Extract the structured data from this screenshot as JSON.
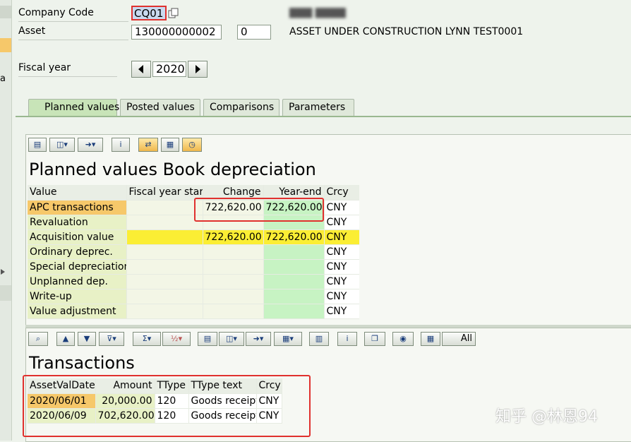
{
  "header": {
    "company_code_label": "Company Code",
    "company_code_value": "CQ01",
    "asset_label": "Asset",
    "asset_number": "130000000002",
    "asset_subnumber": "0",
    "asset_description": "ASSET UNDER CONSTRUCTION LYNN TEST0001",
    "company_name_blurred": "▇▇▇ ▇▇▇▇",
    "fiscal_year_label": "Fiscal year",
    "fiscal_year_value": "2020"
  },
  "left_strip": {
    "text": "a"
  },
  "tabs": [
    {
      "label": "Planned values",
      "active": true
    },
    {
      "label": "Posted values",
      "active": false
    },
    {
      "label": "Comparisons",
      "active": false
    },
    {
      "label": "Parameters",
      "active": false
    }
  ],
  "planned": {
    "title": "Planned values Book depreciation",
    "columns": [
      "Value",
      "Fiscal year start",
      "Change",
      "Year-end",
      "Crcy"
    ],
    "rows": [
      {
        "value": "APC transactions",
        "fy_start": "",
        "change": "722,620.00",
        "year_end": "722,620.00",
        "crcy": "CNY"
      },
      {
        "value": "Revaluation",
        "fy_start": "",
        "change": "",
        "year_end": "",
        "crcy": "CNY"
      },
      {
        "value": "Acquisition value",
        "fy_start": "",
        "change": "722,620.00",
        "year_end": "722,620.00",
        "crcy": "CNY"
      },
      {
        "value": "Ordinary deprec.",
        "fy_start": "",
        "change": "",
        "year_end": "",
        "crcy": "CNY"
      },
      {
        "value": "Special depreciation",
        "fy_start": "",
        "change": "",
        "year_end": "",
        "crcy": "CNY"
      },
      {
        "value": "Unplanned dep.",
        "fy_start": "",
        "change": "",
        "year_end": "",
        "crcy": "CNY"
      },
      {
        "value": "Write-up",
        "fy_start": "",
        "change": "",
        "year_end": "",
        "crcy": "CNY"
      },
      {
        "value": "Value adjustment",
        "fy_start": "",
        "change": "",
        "year_end": "",
        "crcy": "CNY"
      }
    ]
  },
  "transactions": {
    "title": "Transactions",
    "columns": [
      "AssetValDate",
      "Amount",
      "TType",
      "TType text",
      "Crcy"
    ],
    "rows": [
      {
        "date": "2020/06/01",
        "amount": "20,000.00",
        "ttype": "120",
        "ttype_text": "Goods receipt",
        "crcy": "CNY"
      },
      {
        "date": "2020/06/09",
        "amount": "702,620.00",
        "ttype": "120",
        "ttype_text": "Goods receipt",
        "crcy": "CNY"
      }
    ],
    "toolbar_all_label": "All"
  },
  "watermark": "知乎 @林恩94"
}
